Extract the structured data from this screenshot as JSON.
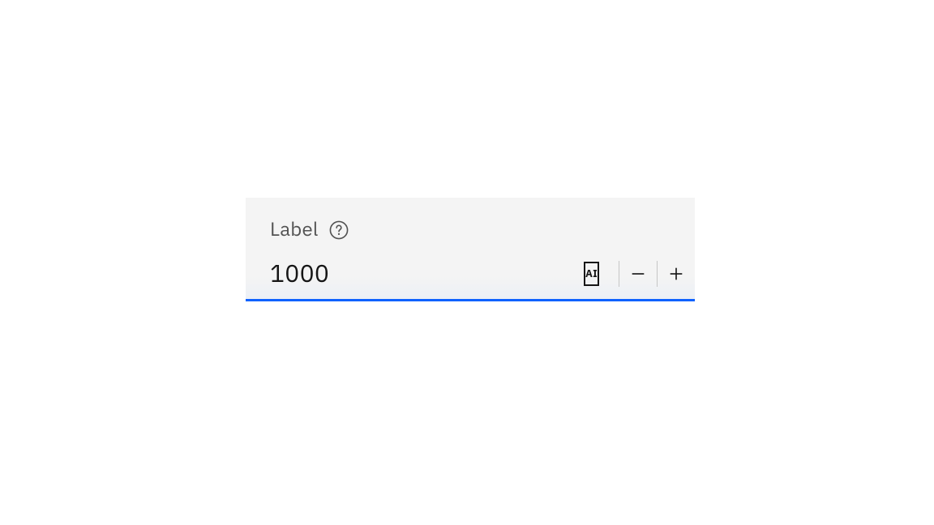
{
  "numberInput": {
    "label": "Label",
    "value": "1000",
    "aiBadge": "AI"
  }
}
